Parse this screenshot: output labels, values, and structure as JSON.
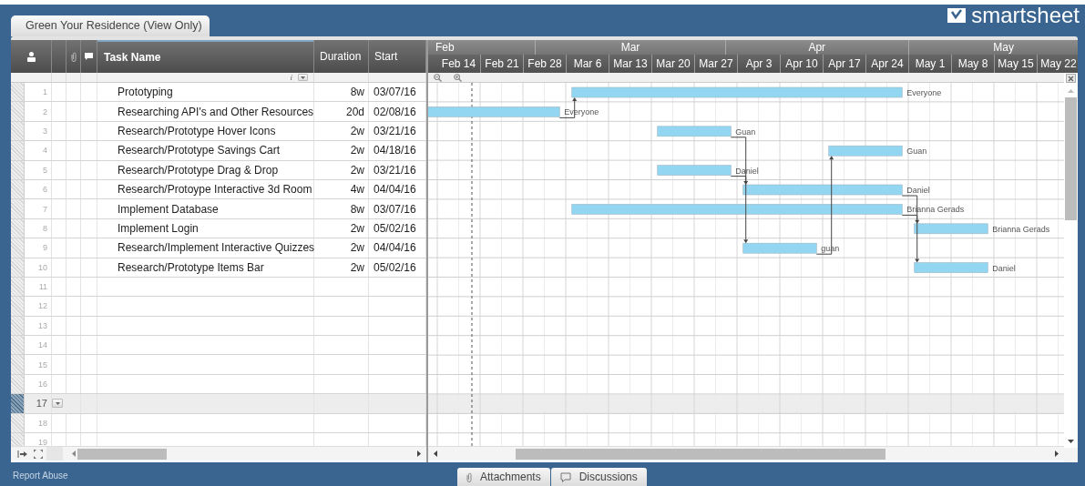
{
  "logo": {
    "text": "smartsheet"
  },
  "sheet_tab": {
    "title": "Green Your Residence (View Only)"
  },
  "grid_header": {
    "task_name": "Task Name",
    "duration": "Duration",
    "start": "Start"
  },
  "filter_row": {
    "info_glyph": "i"
  },
  "rows": [
    {
      "number": "1",
      "task": "Prototyping",
      "duration": "8w",
      "start": "03/07/16",
      "assignee": "Everyone",
      "selected": false
    },
    {
      "number": "2",
      "task": "Researching API's and Other Resources",
      "duration": "20d",
      "start": "02/08/16",
      "assignee": "Everyone",
      "selected": false
    },
    {
      "number": "3",
      "task": "Research/Prototype Hover Icons",
      "duration": "2w",
      "start": "03/21/16",
      "assignee": "Guan",
      "selected": false
    },
    {
      "number": "4",
      "task": "Research/Prototype Savings Cart",
      "duration": "2w",
      "start": "04/18/16",
      "assignee": "Guan",
      "selected": false
    },
    {
      "number": "5",
      "task": "Research/Prototype Drag & Drop",
      "duration": "2w",
      "start": "03/21/16",
      "assignee": "Daniel",
      "selected": false
    },
    {
      "number": "6",
      "task": "Research/Protoype Interactive 3d Room",
      "duration": "4w",
      "start": "04/04/16",
      "assignee": "Daniel",
      "selected": false
    },
    {
      "number": "7",
      "task": "Implement Database",
      "duration": "8w",
      "start": "03/07/16",
      "assignee": "Brianna Gerads",
      "selected": false
    },
    {
      "number": "8",
      "task": "Implement Login",
      "duration": "2w",
      "start": "05/02/16",
      "assignee": "Brianna Gerads",
      "selected": false
    },
    {
      "number": "9",
      "task": "Research/Implement Interactive Quizzes",
      "duration": "2w",
      "start": "04/04/16",
      "assignee": "guan",
      "selected": false
    },
    {
      "number": "10",
      "task": "Research/Prototype Items Bar",
      "duration": "2w",
      "start": "05/02/16",
      "assignee": "Daniel",
      "selected": false
    },
    {
      "number": "11",
      "selected": false
    },
    {
      "number": "12",
      "selected": false
    },
    {
      "number": "13",
      "selected": false
    },
    {
      "number": "14",
      "selected": false
    },
    {
      "number": "15",
      "selected": false
    },
    {
      "number": "16",
      "selected": false
    },
    {
      "number": "17",
      "selected": true
    },
    {
      "number": "18",
      "selected": false
    },
    {
      "number": "19",
      "selected": false
    }
  ],
  "timeline": {
    "months": [
      "Feb",
      "Mar",
      "Apr",
      "May"
    ],
    "weeks": [
      "Feb 14",
      "Feb 21",
      "Feb 28",
      "Mar 6",
      "Mar 13",
      "Mar 20",
      "Mar 27",
      "Apr 3",
      "Apr 10",
      "Apr 17",
      "Apr 24",
      "May 1",
      "May 8",
      "May 15",
      "May 22"
    ]
  },
  "footer": {
    "report_link": "Report Abuse",
    "tabs": [
      {
        "label": "Attachments",
        "kind": "attachments"
      },
      {
        "label": "Discussions",
        "kind": "discussions"
      }
    ]
  }
}
